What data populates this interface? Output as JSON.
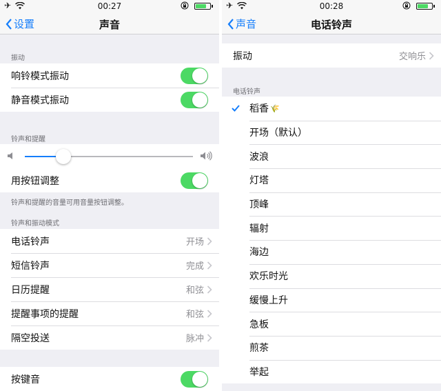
{
  "left": {
    "status": {
      "time": "00:27"
    },
    "nav": {
      "back_label": "设置",
      "title": "声音"
    },
    "vibrate_section": {
      "header": "振动",
      "rows": [
        {
          "label": "响铃模式振动",
          "on": true
        },
        {
          "label": "静音模式振动",
          "on": true
        }
      ]
    },
    "ringer_section": {
      "header": "铃声和提醒",
      "volume": 0.23,
      "buttons_row": {
        "label": "用按钮调整",
        "on": true
      },
      "footer": "铃声和提醒的音量可用音量按钮调整。"
    },
    "patterns_section": {
      "header": "铃声和振动模式",
      "rows": [
        {
          "label": "电话铃声",
          "value": "开场"
        },
        {
          "label": "短信铃声",
          "value": "完成"
        },
        {
          "label": "日历提醒",
          "value": "和弦"
        },
        {
          "label": "提醒事项的提醒",
          "value": "和弦"
        },
        {
          "label": "隔空投送",
          "value": "脉冲"
        }
      ]
    },
    "keyclick_row": {
      "label": "按键音",
      "on": true
    }
  },
  "right": {
    "status": {
      "time": "00:28"
    },
    "nav": {
      "back_label": "声音",
      "title": "电话铃声"
    },
    "vibration_row": {
      "label": "振动",
      "value": "交响乐"
    },
    "ringtones_header": "电话铃声",
    "ringtones": [
      {
        "label": "稻香",
        "selected": true,
        "emoji": "🌾"
      },
      {
        "label": "开场（默认）"
      },
      {
        "label": "波浪"
      },
      {
        "label": "灯塔"
      },
      {
        "label": "顶峰"
      },
      {
        "label": "辐射"
      },
      {
        "label": "海边"
      },
      {
        "label": "欢乐时光"
      },
      {
        "label": "缓慢上升"
      },
      {
        "label": "急板"
      },
      {
        "label": "煎茶"
      },
      {
        "label": "举起"
      }
    ]
  },
  "colors": {
    "accent": "#157efb",
    "toggle_on": "#4cd964",
    "background": "#efeff4",
    "secondary_text": "#8e8e93"
  },
  "icons": [
    "airplane-icon",
    "wifi-icon",
    "orientation-lock-icon",
    "battery-icon",
    "back-chevron-icon",
    "disclosure-chevron-icon",
    "speaker-low-icon",
    "speaker-high-icon",
    "checkmark-icon"
  ]
}
